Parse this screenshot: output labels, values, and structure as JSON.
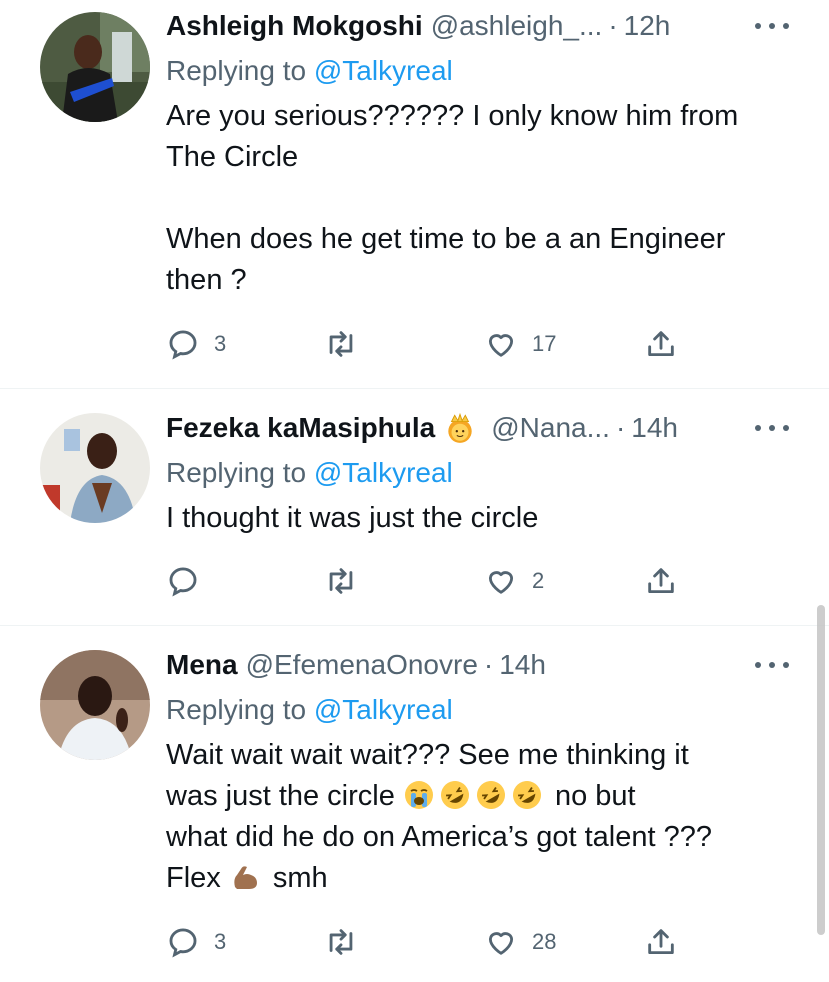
{
  "tweets": [
    {
      "name": "Ashleigh Mokgoshi",
      "handle": "@ashleigh_...",
      "time": "12h",
      "replying_prefix": "Replying to ",
      "replying_to": "@Talkyreal",
      "text": "Are you serious?????? I only know him from\nThe Circle\n\nWhen does he get time to be a an Engineer\nthen ?",
      "replies": "3",
      "retweets": "",
      "likes": "17"
    },
    {
      "name": "Fezeka kaMasiphula",
      "handle": "@Nana...",
      "time": "14h",
      "replying_prefix": "Replying to ",
      "replying_to": "@Talkyreal",
      "text": "I thought it was just the circle",
      "replies": "",
      "retweets": "",
      "likes": "2"
    },
    {
      "name": "Mena",
      "handle": "@EfemenaOnovre",
      "time": "14h",
      "replying_prefix": "Replying to ",
      "replying_to": "@Talkyreal",
      "text_line1": "Wait wait wait wait??? See me thinking it",
      "text_line2_a": "was just the circle ",
      "text_line2_b": " no but",
      "text_line3": "what did he do on America’s got talent ???",
      "text_line4_a": "Flex ",
      "text_line4_b": " smh",
      "replies": "3",
      "retweets": "",
      "likes": "28"
    }
  ],
  "icons": {
    "reply": "reply-icon",
    "retweet": "retweet-icon",
    "like": "like-icon",
    "share": "share-icon",
    "more": "more-icon"
  },
  "colors": {
    "link": "#1d9bf0",
    "secondary": "#536471",
    "text": "#0f1419",
    "divider": "#eff3f4"
  }
}
